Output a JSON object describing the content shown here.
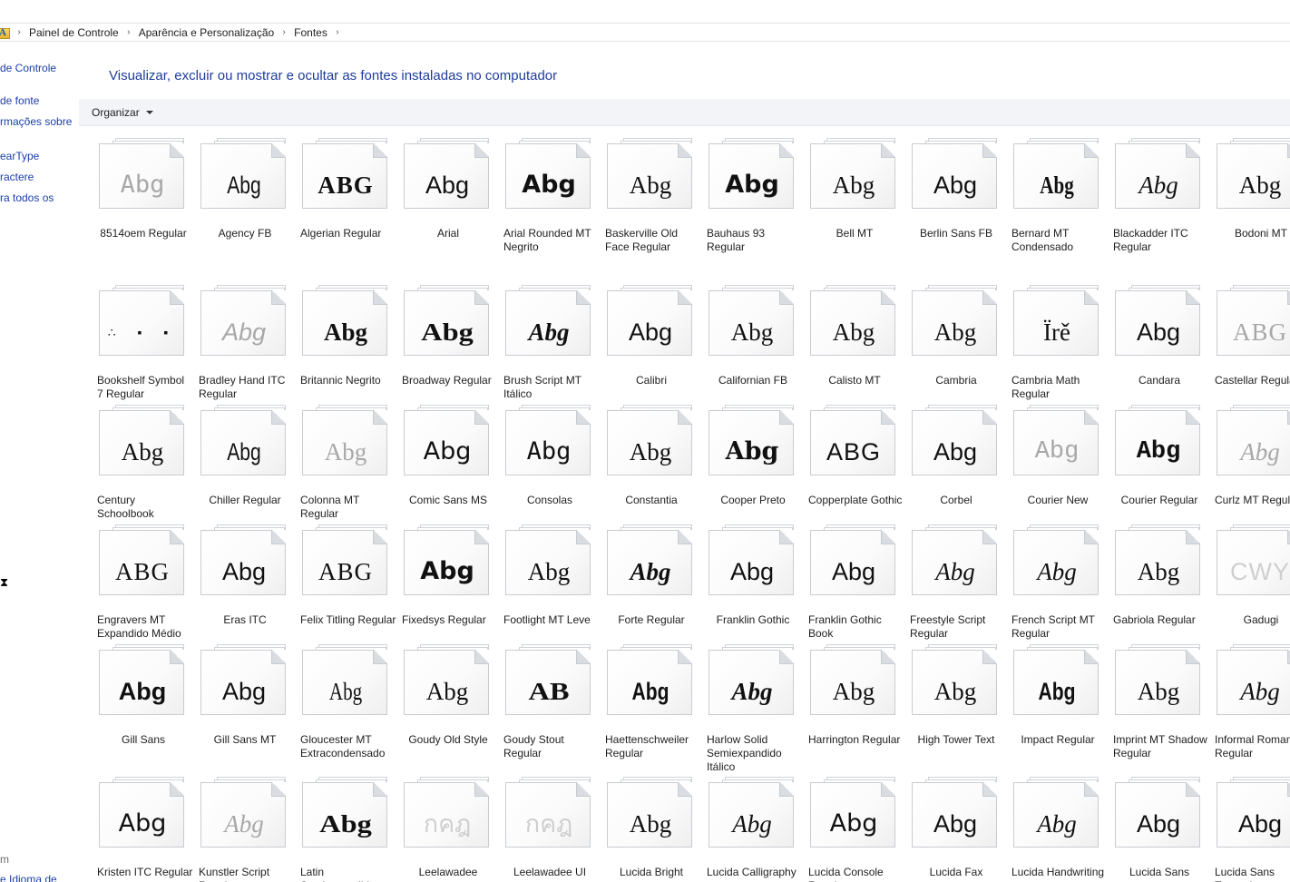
{
  "breadcrumb": {
    "items": [
      "Painel de Controle",
      "Aparência e Personalização",
      "Fontes"
    ]
  },
  "leftnav": {
    "links": [
      "de Controle",
      "de fonte",
      "rmações sobre",
      "earType",
      "ractere",
      "ra todos os"
    ],
    "footer": [
      "m",
      "e Idioma de"
    ]
  },
  "page": {
    "title": "Visualizar, excluir ou mostrar e ocultar as fontes instaladas no computador"
  },
  "toolbar": {
    "organize_label": "Organizar"
  },
  "fonts": [
    [
      {
        "name": "8514oem Regular",
        "sample": "Abg"
      },
      {
        "name": "Agency FB",
        "sample": "Abg"
      },
      {
        "name": "Algerian Regular",
        "sample": "ABG"
      },
      {
        "name": "Arial",
        "sample": "Abg"
      },
      {
        "name": "Arial Rounded MT Negrito",
        "sample": "Abg"
      },
      {
        "name": "Baskerville Old Face Regular",
        "sample": "Abg"
      },
      {
        "name": "Bauhaus 93 Regular",
        "sample": "Abg"
      },
      {
        "name": "Bell MT",
        "sample": "Abg"
      },
      {
        "name": "Berlin Sans FB",
        "sample": "Abg"
      },
      {
        "name": "Bernard MT Condensado",
        "sample": "Abg"
      },
      {
        "name": "Blackadder ITC Regular",
        "sample": "Abg"
      },
      {
        "name": "Bodoni MT",
        "sample": "Abg"
      }
    ],
    [
      {
        "name": "Bookshelf Symbol 7 Regular",
        "sample": "∴ ▪ ▪"
      },
      {
        "name": "Bradley Hand ITC Regular",
        "sample": "Abg"
      },
      {
        "name": "Britannic Negrito",
        "sample": "Abg"
      },
      {
        "name": "Broadway Regular",
        "sample": "Abg"
      },
      {
        "name": "Brush Script MT Itálico",
        "sample": "Abg"
      },
      {
        "name": "Calibri",
        "sample": "Abg"
      },
      {
        "name": "Californian FB",
        "sample": "Abg"
      },
      {
        "name": "Calisto MT",
        "sample": "Abg"
      },
      {
        "name": "Cambria",
        "sample": "Abg"
      },
      {
        "name": "Cambria Math Regular",
        "sample": "Ïrě"
      },
      {
        "name": "Candara",
        "sample": "Abg"
      },
      {
        "name": "Castellar Regular",
        "sample": "ABG"
      }
    ],
    [
      {
        "name": "Century Schoolbook",
        "sample": "Abg"
      },
      {
        "name": "Chiller Regular",
        "sample": "Abg"
      },
      {
        "name": "Colonna MT Regular",
        "sample": "Abg"
      },
      {
        "name": "Comic Sans MS",
        "sample": "Abg"
      },
      {
        "name": "Consolas",
        "sample": "Abg"
      },
      {
        "name": "Constantia",
        "sample": "Abg"
      },
      {
        "name": "Cooper Preto",
        "sample": "Abg"
      },
      {
        "name": "Copperplate Gothic",
        "sample": "ABG"
      },
      {
        "name": "Corbel",
        "sample": "Abg"
      },
      {
        "name": "Courier New",
        "sample": "Abg"
      },
      {
        "name": "Courier Regular",
        "sample": "Abg"
      },
      {
        "name": "Curlz MT Regular",
        "sample": "Abg"
      }
    ],
    [
      {
        "name": "Engravers MT Expandido Médio",
        "sample": "ABG"
      },
      {
        "name": "Eras ITC",
        "sample": "Abg"
      },
      {
        "name": "Felix Titling Regular",
        "sample": "ABG"
      },
      {
        "name": "Fixedsys Regular",
        "sample": "Abg"
      },
      {
        "name": "Footlight MT Leve",
        "sample": "Abg"
      },
      {
        "name": "Forte Regular",
        "sample": "Abg"
      },
      {
        "name": "Franklin Gothic",
        "sample": "Abg"
      },
      {
        "name": "Franklin Gothic Book",
        "sample": "Abg"
      },
      {
        "name": "Freestyle Script Regular",
        "sample": "Abg"
      },
      {
        "name": "French Script MT Regular",
        "sample": "Abg"
      },
      {
        "name": "Gabriola Regular",
        "sample": "Abg"
      },
      {
        "name": "Gadugi",
        "sample": "CWY"
      }
    ],
    [
      {
        "name": "Gill Sans",
        "sample": "Abg"
      },
      {
        "name": "Gill Sans MT",
        "sample": "Abg"
      },
      {
        "name": "Gloucester MT Extracondensado",
        "sample": "Abg"
      },
      {
        "name": "Goudy Old Style",
        "sample": "Abg"
      },
      {
        "name": "Goudy Stout Regular",
        "sample": "AB"
      },
      {
        "name": "Haettenschweiler Regular",
        "sample": "Abg"
      },
      {
        "name": "Harlow Solid Semiexpandido Itálico",
        "sample": "Abg"
      },
      {
        "name": "Harrington Regular",
        "sample": "Abg"
      },
      {
        "name": "High Tower Text",
        "sample": "Abg"
      },
      {
        "name": "Impact Regular",
        "sample": "Abg"
      },
      {
        "name": "Imprint MT Shadow Regular",
        "sample": "Abg"
      },
      {
        "name": "Informal Roman Regular",
        "sample": "Abg"
      }
    ],
    [
      {
        "name": "Kristen ITC Regular",
        "sample": "Abg"
      },
      {
        "name": "Kunstler Script Regular",
        "sample": "Abg"
      },
      {
        "name": "Latin Semiexpandido",
        "sample": "Abg"
      },
      {
        "name": "Leelawadee",
        "sample": "กคฎ"
      },
      {
        "name": "Leelawadee UI",
        "sample": "กคฎ"
      },
      {
        "name": "Lucida Bright",
        "sample": "Abg"
      },
      {
        "name": "Lucida Calligraphy",
        "sample": "Abg"
      },
      {
        "name": "Lucida Console Regular",
        "sample": "Abg"
      },
      {
        "name": "Lucida Fax",
        "sample": "Abg"
      },
      {
        "name": "Lucida Handwriting",
        "sample": "Abg"
      },
      {
        "name": "Lucida Sans",
        "sample": "Abg"
      },
      {
        "name": "Lucida Sans Typewriter",
        "sample": "Abg"
      }
    ]
  ]
}
